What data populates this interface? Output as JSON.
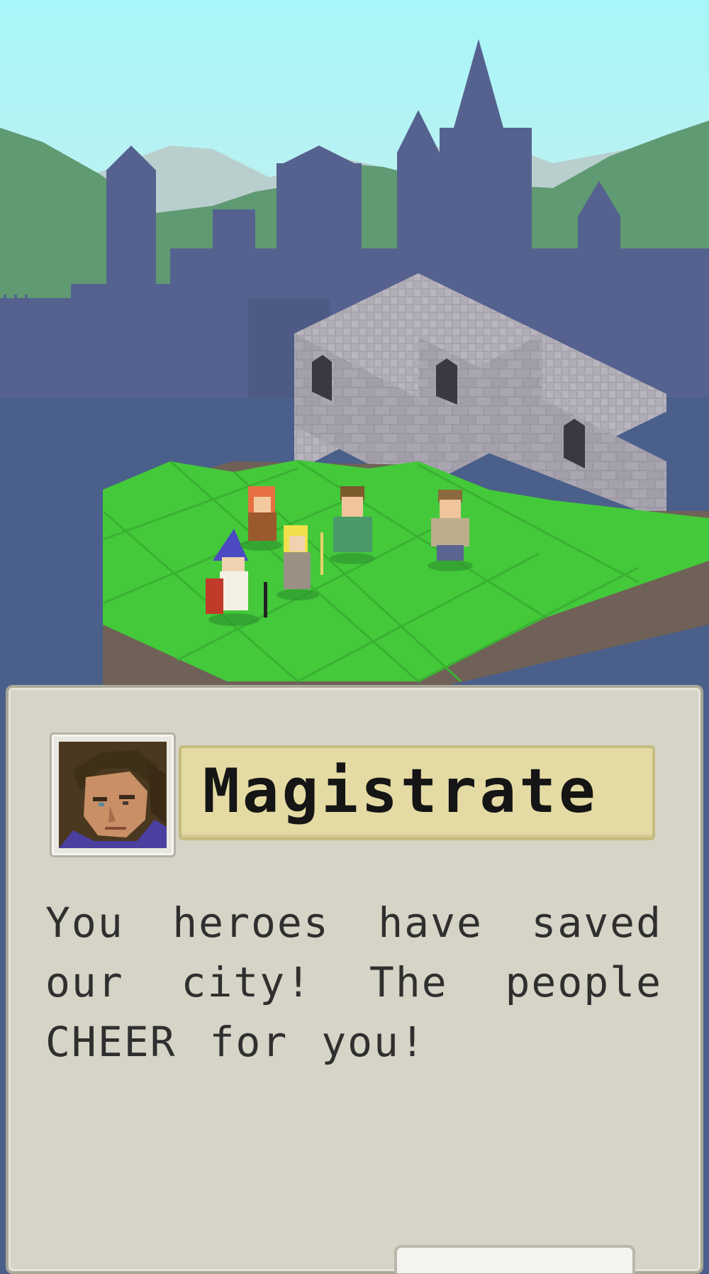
{
  "dialog": {
    "speaker": "Magistrate",
    "text": "You heroes have saved our city! The people CHEER for you!"
  },
  "icons": {
    "portrait": "magistrate-portrait-icon"
  },
  "colors": {
    "sky_top": "#a7f3f6",
    "sky_bottom": "#c8eef0",
    "castle": "#53618f",
    "grass": "#43c93a",
    "wall": "#a9a5b0",
    "dialog_bg": "#d6d4c6",
    "nameplate_bg": "#e4dba4"
  }
}
